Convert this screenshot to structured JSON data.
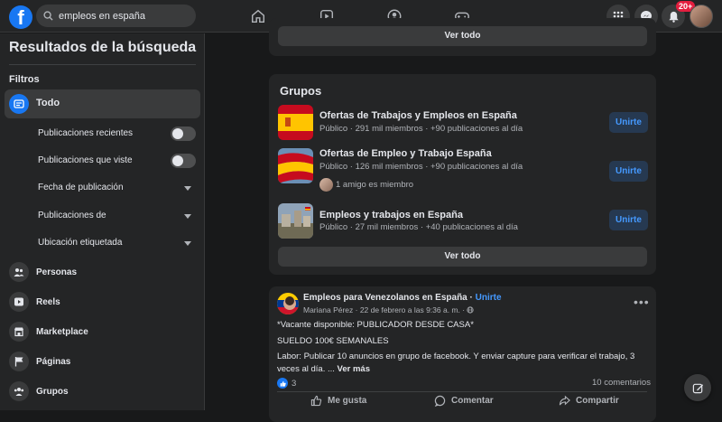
{
  "search": {
    "value": "empleos en españa"
  },
  "notifications": {
    "badge": "20+"
  },
  "sidebar": {
    "title": "Resultados de la búsqueda",
    "filters_label": "Filtros",
    "active_item": "Todo",
    "sub_filters": [
      {
        "label": "Publicaciones recientes",
        "control": "toggle"
      },
      {
        "label": "Publicaciones que viste",
        "control": "toggle"
      },
      {
        "label": "Fecha de publicación",
        "control": "dropdown"
      },
      {
        "label": "Publicaciones de",
        "control": "dropdown"
      },
      {
        "label": "Ubicación etiquetada",
        "control": "dropdown"
      }
    ],
    "items": [
      {
        "label": "Personas",
        "icon": "people-icon"
      },
      {
        "label": "Reels",
        "icon": "reels-icon"
      },
      {
        "label": "Marketplace",
        "icon": "marketplace-icon"
      },
      {
        "label": "Páginas",
        "icon": "flag-icon"
      },
      {
        "label": "Grupos",
        "icon": "groups-icon"
      }
    ]
  },
  "top_card": {
    "see_all": "Ver todo"
  },
  "groups": {
    "title": "Grupos",
    "items": [
      {
        "name": "Ofertas de Trabajos y Empleos en España",
        "meta": "Público · 291 mil miembros · +90 publicaciones al día",
        "join": "Unirte"
      },
      {
        "name": "Ofertas de Empleo y Trabajo España",
        "meta": "Público · 126 mil miembros · +90 publicaciones al día",
        "friends": "1 amigo es miembro",
        "join": "Unirte"
      },
      {
        "name": "Empleos y trabajos en España",
        "meta": "Público · 27 mil miembros · +40 publicaciones al día",
        "join": "Unirte"
      }
    ],
    "see_all": "Ver todo"
  },
  "post": {
    "group": "Empleos para Venezolanos en España",
    "separator": " · ",
    "join_link": "Unirte",
    "author_line": "Mariana Pérez · 22 de febrero a las 9:36 a. m. ·",
    "lines": [
      "*Vacante disponible: PUBLICADOR DESDE CASA*",
      "SUELDO 100€ SEMANALES",
      "Labor: Publicar 10 anuncios en grupo de facebook. Y enviar capture para verificar el trabajo, 3 veces al día. ..."
    ],
    "see_more": "Ver más",
    "reaction_count": "3",
    "comments": "10 comentarios",
    "actions": {
      "like": "Me gusta",
      "comment": "Comentar",
      "share": "Compartir"
    }
  },
  "colors": {
    "accent": "#1877f2",
    "background": "#18191a",
    "surface": "#242526",
    "link": "#4599ff"
  }
}
